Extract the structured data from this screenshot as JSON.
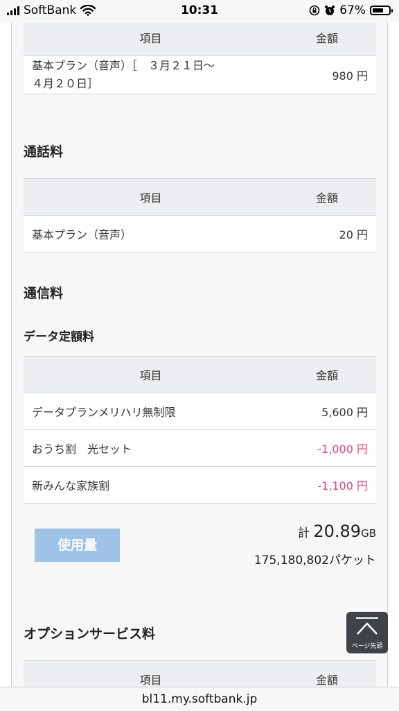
{
  "status_bar": {
    "carrier": "SoftBank",
    "time": "10:31",
    "battery_percent": "67%",
    "battery_level": 0.67
  },
  "basic_table": {
    "header_item": "項目",
    "header_amount": "金額",
    "row_item_line1": "基本プラン（音声）［　３月２１日〜",
    "row_item_line2": "４月２０日］",
    "row_amount": "980",
    "row_unit": "円"
  },
  "call_section": {
    "title": "通話料",
    "header_item": "項目",
    "header_amount": "金額",
    "row_item": "基本プラン（音声）",
    "row_amount": "20",
    "row_unit": "円"
  },
  "comm_section": {
    "title": "通信料",
    "subtitle": "データ定額料",
    "header_item": "項目",
    "header_amount": "金額",
    "rows": [
      {
        "item": "データプランメリハリ無制限",
        "amount": "5,600",
        "unit": "円"
      },
      {
        "item": "おうち割　光セット",
        "amount": "-1,000",
        "unit": "円"
      },
      {
        "item": "新みんな家族割",
        "amount": "-1,100",
        "unit": "円"
      }
    ],
    "negative_color": "#e8417a"
  },
  "usage": {
    "button_label": "使用量",
    "total_prefix": "計",
    "total_value": "20.89",
    "total_unit": "GB",
    "packets": "175,180,802パケット"
  },
  "option_section": {
    "title": "オプションサービス料",
    "header_item": "項目",
    "header_amount": "金額"
  },
  "page_top": {
    "label": "ページ先頭"
  },
  "url_bar": {
    "url": "bl11.my.softbank.jp"
  },
  "colors": {
    "button_bg": "#9ec3e6",
    "header_bg": "#eceef1"
  }
}
